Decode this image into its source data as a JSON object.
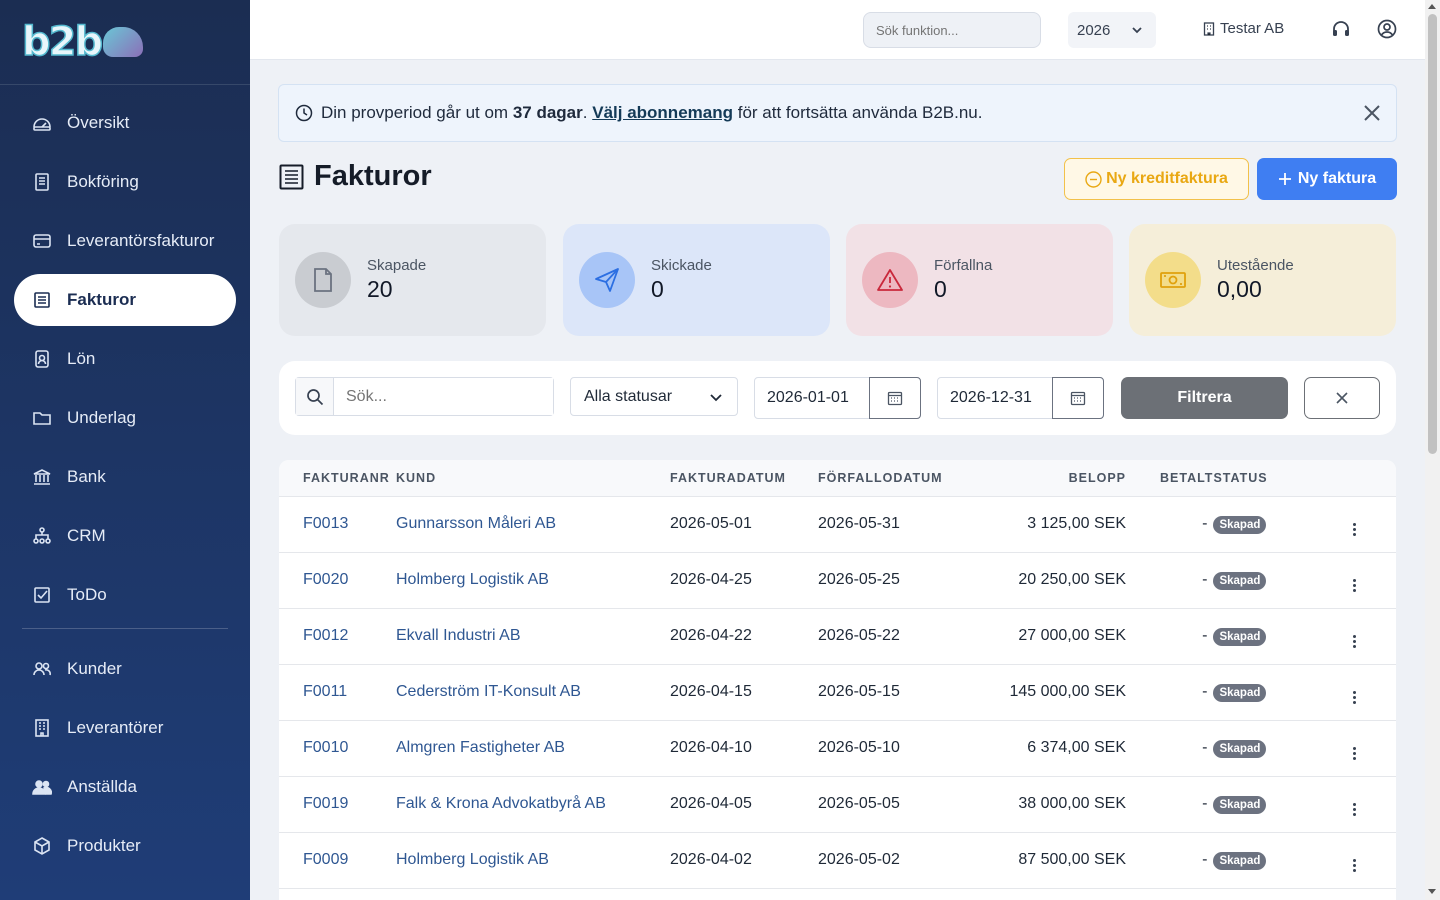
{
  "app": {
    "logo_text": "b2b"
  },
  "sidebar": {
    "items": [
      {
        "label": "Översikt"
      },
      {
        "label": "Bokföring"
      },
      {
        "label": "Leverantörsfakturor"
      },
      {
        "label": "Fakturor",
        "active": true
      },
      {
        "label": "Lön"
      },
      {
        "label": "Underlag"
      },
      {
        "label": "Bank"
      },
      {
        "label": "CRM"
      },
      {
        "label": "ToDo"
      },
      {
        "label": "Kunder"
      },
      {
        "label": "Leverantörer"
      },
      {
        "label": "Anställda"
      },
      {
        "label": "Produkter"
      }
    ]
  },
  "topbar": {
    "search_placeholder": "Sök funktion...",
    "year": "2026",
    "company": "Testar AB"
  },
  "banner": {
    "text_before": "Din provperiod går ut om",
    "days": "37 dagar",
    "text_mid": ".",
    "link": "Välj abonnemang",
    "text_after": "för att fortsätta använda B2B.nu."
  },
  "page": {
    "title": "Fakturor"
  },
  "actions": {
    "credit_label": "Ny kreditfaktura",
    "new_label": "Ny faktura"
  },
  "stats": [
    {
      "label": "Skapade",
      "value": "20"
    },
    {
      "label": "Skickade",
      "value": "0"
    },
    {
      "label": "Förfallna",
      "value": "0"
    },
    {
      "label": "Utestående",
      "value": "0,00"
    }
  ],
  "filters": {
    "search_placeholder": "Sök...",
    "status": "Alla statusar",
    "date_from": "2026-01-01",
    "date_to": "2026-12-31",
    "filter_label": "Filtrera"
  },
  "table": {
    "headers": [
      "FAKTURANR",
      "KUND",
      "FAKTURADATUM",
      "FÖRFALLODATUM",
      "BELOPP",
      "BETALT",
      "STATUS"
    ],
    "rows": [
      {
        "nr": "F0013",
        "kund": "Gunnarsson Måleri AB",
        "datum": "2026-05-01",
        "forfallo": "2026-05-31",
        "belopp": "3 125,00 SEK",
        "betalt": "-",
        "status": "Skapad"
      },
      {
        "nr": "F0020",
        "kund": "Holmberg Logistik AB",
        "datum": "2026-04-25",
        "forfallo": "2026-05-25",
        "belopp": "20 250,00 SEK",
        "betalt": "-",
        "status": "Skapad"
      },
      {
        "nr": "F0012",
        "kund": "Ekvall Industri AB",
        "datum": "2026-04-22",
        "forfallo": "2026-05-22",
        "belopp": "27 000,00 SEK",
        "betalt": "-",
        "status": "Skapad"
      },
      {
        "nr": "F0011",
        "kund": "Cederström IT-Konsult AB",
        "datum": "2026-04-15",
        "forfallo": "2026-05-15",
        "belopp": "145 000,00 SEK",
        "betalt": "-",
        "status": "Skapad"
      },
      {
        "nr": "F0010",
        "kund": "Almgren Fastigheter AB",
        "datum": "2026-04-10",
        "forfallo": "2026-05-10",
        "belopp": "6 374,00 SEK",
        "betalt": "-",
        "status": "Skapad"
      },
      {
        "nr": "F0019",
        "kund": "Falk & Krona Advokatbyrå AB",
        "datum": "2026-04-05",
        "forfallo": "2026-05-05",
        "belopp": "38 000,00 SEK",
        "betalt": "-",
        "status": "Skapad"
      },
      {
        "nr": "F0009",
        "kund": "Holmberg Logistik AB",
        "datum": "2026-04-02",
        "forfallo": "2026-05-02",
        "belopp": "87 500,00 SEK",
        "betalt": "-",
        "status": "Skapad"
      }
    ]
  }
}
